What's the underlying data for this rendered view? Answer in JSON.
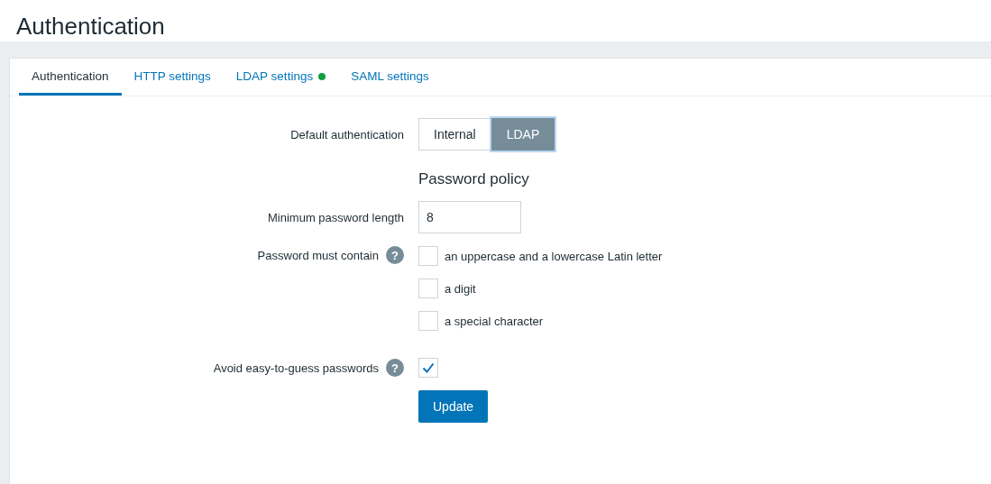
{
  "page_title": "Authentication",
  "tabs": [
    {
      "label": "Authentication",
      "selected": true,
      "indicator": false
    },
    {
      "label": "HTTP settings",
      "selected": false,
      "indicator": false
    },
    {
      "label": "LDAP settings",
      "selected": false,
      "indicator": true
    },
    {
      "label": "SAML settings",
      "selected": false,
      "indicator": false
    }
  ],
  "default_authentication": {
    "label": "Default authentication",
    "options": [
      {
        "label": "Internal",
        "selected": false
      },
      {
        "label": "LDAP",
        "selected": true
      }
    ]
  },
  "password_policy": {
    "heading": "Password policy",
    "min_length": {
      "label": "Minimum password length",
      "value": "8"
    },
    "must_contain": {
      "label": "Password must contain",
      "help": "?",
      "options": [
        {
          "label": "an uppercase and a lowercase Latin letter",
          "checked": false
        },
        {
          "label": "a digit",
          "checked": false
        },
        {
          "label": "a special character",
          "checked": false
        }
      ]
    },
    "avoid_easy": {
      "label": "Avoid easy-to-guess passwords",
      "help": "?",
      "checked": true
    }
  },
  "update_button": "Update"
}
